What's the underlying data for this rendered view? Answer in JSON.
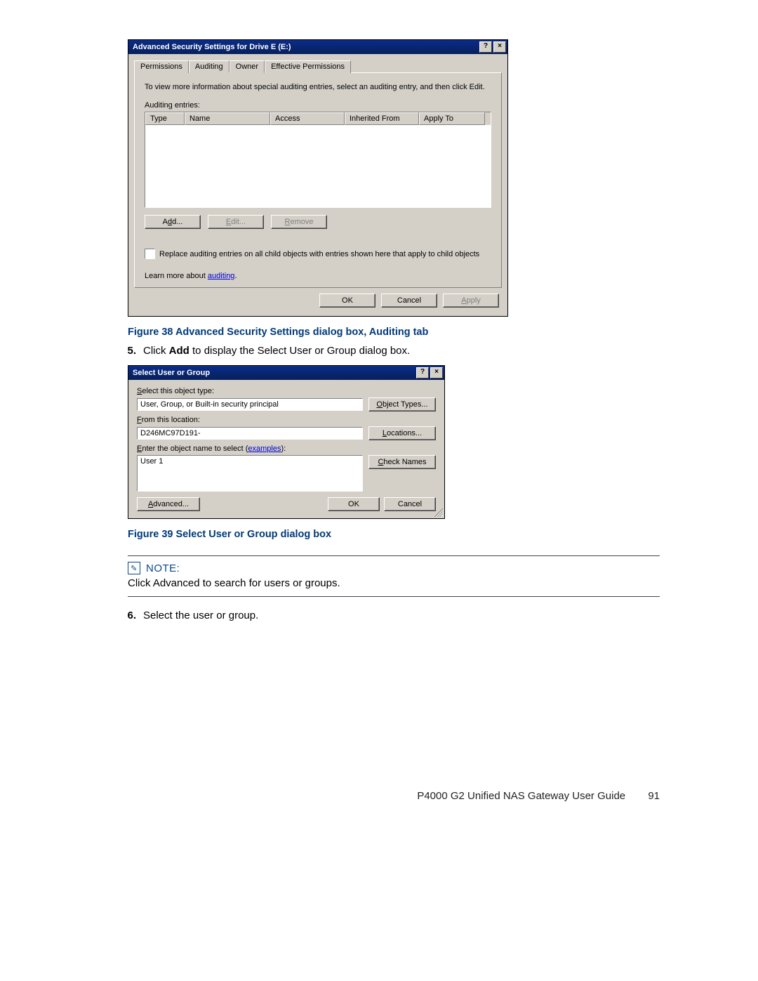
{
  "dialog1": {
    "title": "Advanced Security Settings for Drive E (E:)",
    "tabs": [
      "Permissions",
      "Auditing",
      "Owner",
      "Effective Permissions"
    ],
    "instruction": "To view more information about special auditing entries, select an auditing entry, and then click Edit.",
    "entries_label": "Auditing entries:",
    "columns": {
      "type": "Type",
      "name": "Name",
      "access": "Access",
      "inherited": "Inherited From",
      "apply": "Apply To"
    },
    "buttons": {
      "add": "Add...",
      "edit": "Edit...",
      "remove": "Remove"
    },
    "checkbox": "Replace auditing entries on all child objects with entries shown here that apply to child objects",
    "learn_prefix": "Learn more about ",
    "learn_link": "auditing",
    "footer": {
      "ok": "OK",
      "cancel": "Cancel",
      "apply": "Apply"
    }
  },
  "caption1": "Figure 38 Advanced Security Settings dialog box, Auditing tab",
  "step5_num": "5.",
  "step5_a": "Click ",
  "step5_bold": "Add",
  "step5_b": " to display the Select User or Group dialog box.",
  "dialog2": {
    "title": "Select User or Group",
    "obj_label": "Select this object type:",
    "obj_value": "User, Group, or Built-in security principal",
    "obj_btn": "Object Types...",
    "loc_label": "From this location:",
    "loc_value": "D246MC97D191-",
    "loc_btn": "Locations...",
    "name_label_a": "Enter the object name to select (",
    "name_label_link": "examples",
    "name_label_b": "):",
    "name_value": "User 1",
    "check_btn": "Check Names",
    "advanced_btn": "Advanced...",
    "ok": "OK",
    "cancel": "Cancel"
  },
  "caption2": "Figure 39 Select User or Group dialog box",
  "note_label": "NOTE:",
  "note_text": "Click Advanced to search for users or groups.",
  "step6_num": "6.",
  "step6": "Select the user or group.",
  "footer_doc": "P4000 G2 Unified NAS Gateway User Guide",
  "page_num": "91"
}
